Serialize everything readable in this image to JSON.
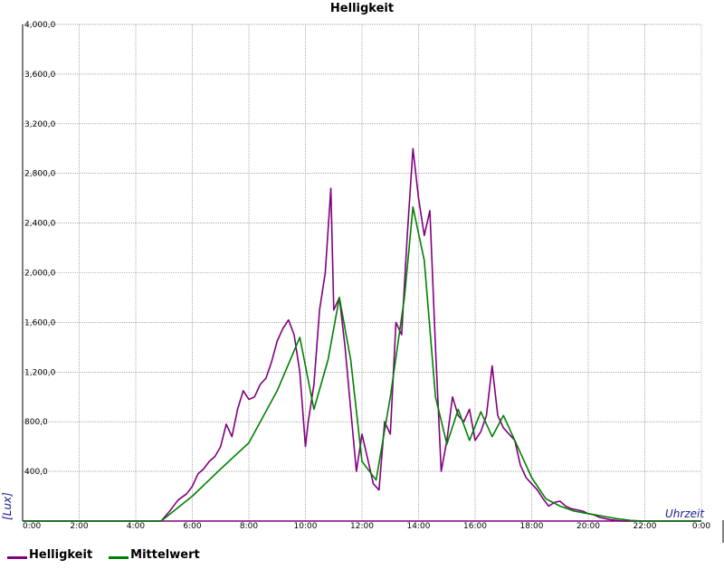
{
  "chart_data": {
    "type": "line",
    "title": "Helligkeit",
    "xlabel": "Uhrzeit",
    "ylabel": "[Lux]",
    "xlim": [
      0,
      24
    ],
    "ylim": [
      0,
      4000
    ],
    "x_ticks": [
      "0:00",
      "2:00",
      "4:00",
      "6:00",
      "8:00",
      "10:00",
      "12:00",
      "14:00",
      "16:00",
      "18:00",
      "20:00",
      "22:00",
      "0:00"
    ],
    "y_ticks": [
      "400,0",
      "800,0",
      "1,200,0",
      "1,600,0",
      "2,000,0",
      "2,400,0",
      "2,800,0",
      "3,200,0",
      "3,600,0",
      "4,000,0"
    ],
    "y_tick_values": [
      400,
      800,
      1200,
      1600,
      2000,
      2400,
      2800,
      3200,
      3600,
      4000
    ],
    "grid": true,
    "legend_position": "bottom-left",
    "series": [
      {
        "name": "Helligkeit",
        "color": "#800080",
        "x": [
          0,
          4.9,
          5.2,
          5.5,
          5.8,
          6.0,
          6.2,
          6.4,
          6.6,
          6.8,
          7.0,
          7.2,
          7.4,
          7.6,
          7.8,
          8.0,
          8.2,
          8.4,
          8.6,
          8.8,
          9.0,
          9.2,
          9.4,
          9.6,
          9.8,
          10.0,
          10.1,
          10.3,
          10.5,
          10.7,
          10.9,
          11.0,
          11.2,
          11.4,
          11.6,
          11.8,
          12.0,
          12.2,
          12.4,
          12.6,
          12.8,
          13.0,
          13.2,
          13.4,
          13.6,
          13.8,
          14.0,
          14.2,
          14.4,
          14.6,
          14.8,
          15.0,
          15.2,
          15.4,
          15.6,
          15.8,
          16.0,
          16.2,
          16.4,
          16.6,
          16.8,
          17.0,
          17.2,
          17.4,
          17.6,
          17.8,
          18.0,
          18.2,
          18.4,
          18.6,
          18.8,
          19.0,
          19.2,
          19.4,
          19.6,
          19.8,
          20.0,
          20.2,
          20.4,
          20.6,
          20.8,
          21.0,
          21.2,
          21.4,
          21.6,
          22.0,
          24.0
        ],
        "values": [
          0,
          0,
          80,
          170,
          220,
          280,
          380,
          420,
          480,
          520,
          600,
          780,
          680,
          900,
          1050,
          980,
          1000,
          1100,
          1150,
          1280,
          1450,
          1550,
          1620,
          1500,
          1200,
          600,
          800,
          1100,
          1700,
          2000,
          2680,
          1700,
          1800,
          1400,
          900,
          400,
          700,
          500,
          300,
          250,
          800,
          700,
          1600,
          1500,
          2300,
          3000,
          2600,
          2300,
          2500,
          1400,
          400,
          650,
          1000,
          850,
          800,
          900,
          650,
          720,
          850,
          1250,
          850,
          750,
          700,
          650,
          450,
          350,
          300,
          250,
          180,
          120,
          150,
          160,
          120,
          100,
          90,
          80,
          60,
          50,
          30,
          20,
          10,
          5,
          0,
          0,
          0,
          0,
          0
        ]
      },
      {
        "name": "Mittelwert",
        "color": "#008000",
        "x": [
          0,
          4.9,
          6.0,
          7.0,
          8.0,
          9.0,
          9.8,
          10.3,
          10.8,
          11.2,
          11.6,
          12.0,
          12.5,
          13.0,
          13.5,
          13.8,
          14.2,
          14.6,
          15.0,
          15.4,
          15.8,
          16.2,
          16.6,
          17.0,
          17.5,
          18.0,
          18.5,
          19.0,
          19.5,
          20.0,
          20.5,
          21.0,
          21.5,
          22.0,
          24.0
        ],
        "values": [
          0,
          0,
          200,
          420,
          630,
          1050,
          1480,
          900,
          1300,
          1800,
          1300,
          480,
          330,
          1000,
          1800,
          2530,
          2100,
          1000,
          620,
          900,
          650,
          880,
          680,
          850,
          600,
          350,
          180,
          120,
          80,
          60,
          40,
          20,
          5,
          0,
          0
        ]
      }
    ]
  },
  "legend": {
    "items": [
      {
        "label": "Helligkeit",
        "color": "#800080"
      },
      {
        "label": "Mittelwert",
        "color": "#008000"
      }
    ]
  }
}
